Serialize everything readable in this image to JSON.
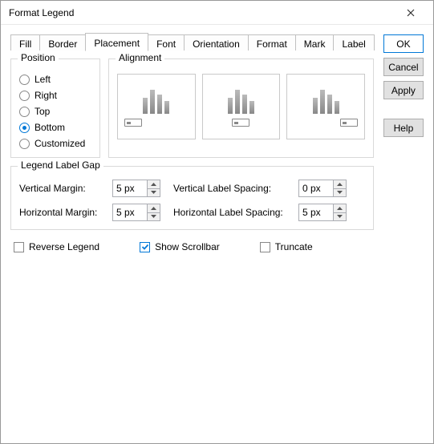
{
  "window": {
    "title": "Format Legend"
  },
  "tabs": {
    "items": [
      "Fill",
      "Border",
      "Placement",
      "Font",
      "Orientation",
      "Format",
      "Mark",
      "Label"
    ],
    "active": 2
  },
  "position": {
    "legend": "Position",
    "options": [
      "Left",
      "Right",
      "Top",
      "Bottom",
      "Customized"
    ],
    "selected": 3
  },
  "alignment": {
    "legend": "Alignment"
  },
  "gap": {
    "legend": "Legend Label Gap",
    "vmargin_label": "Vertical Margin:",
    "vmargin_value": "5 px",
    "hmargin_label": "Horizontal Margin:",
    "hmargin_value": "5 px",
    "vspacing_label": "Vertical Label Spacing:",
    "vspacing_value": "0 px",
    "hspacing_label": "Horizontal Label Spacing:",
    "hspacing_value": "5 px"
  },
  "checks": {
    "reverse_label": "Reverse Legend",
    "reverse_checked": false,
    "scrollbar_label": "Show Scrollbar",
    "scrollbar_checked": true,
    "truncate_label": "Truncate",
    "truncate_checked": false
  },
  "buttons": {
    "ok": "OK",
    "cancel": "Cancel",
    "apply": "Apply",
    "help": "Help"
  }
}
